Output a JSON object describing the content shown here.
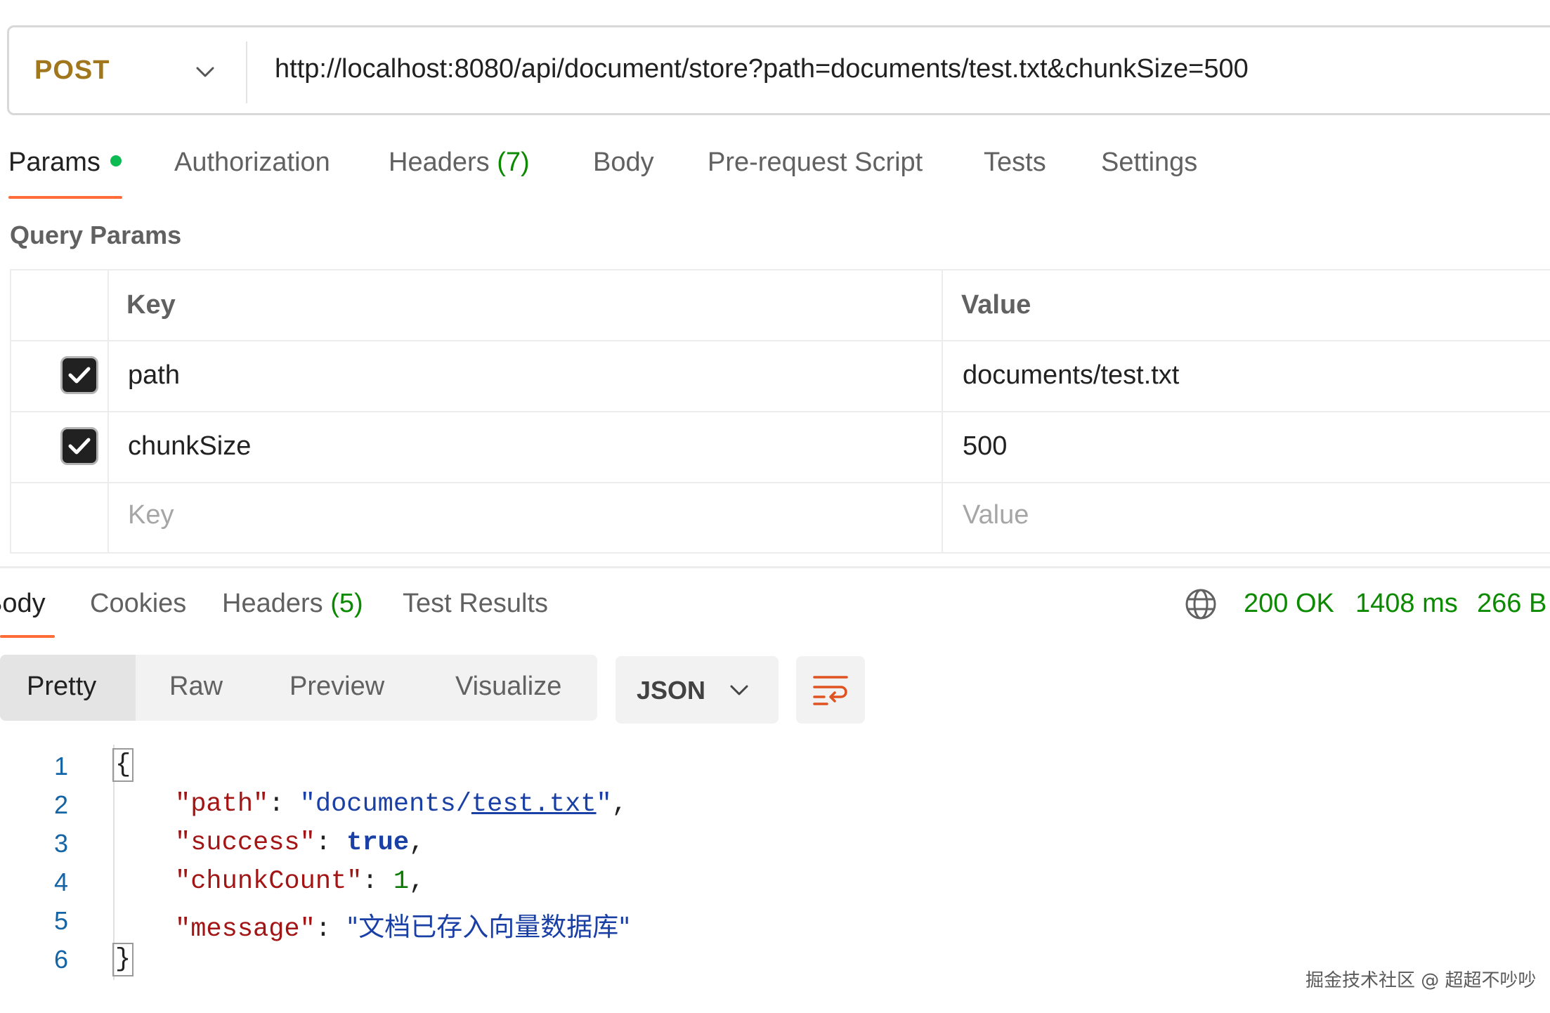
{
  "request": {
    "method": "POST",
    "url": "http://localhost:8080/api/document/store?path=documents/test.txt&chunkSize=500"
  },
  "request_tabs": [
    {
      "label": "Params",
      "active": true
    },
    {
      "label": "Authorization"
    },
    {
      "label": "Headers",
      "count": "(7)"
    },
    {
      "label": "Body"
    },
    {
      "label": "Pre-request Script"
    },
    {
      "label": "Tests"
    },
    {
      "label": "Settings"
    }
  ],
  "query_params": {
    "title": "Query Params",
    "columns": [
      "Key",
      "Value"
    ],
    "rows": [
      {
        "checked": true,
        "key": "path",
        "value": "documents/test.txt"
      },
      {
        "checked": true,
        "key": "chunkSize",
        "value": "500"
      }
    ],
    "placeholder": {
      "key": "Key",
      "value": "Value"
    }
  },
  "response_tabs": [
    {
      "label": "Body",
      "active": true
    },
    {
      "label": "Cookies"
    },
    {
      "label": "Headers",
      "count": "(5)"
    },
    {
      "label": "Test Results"
    }
  ],
  "response_meta": {
    "status": "200 OK",
    "time": "1408 ms",
    "size": "266 B"
  },
  "format_tabs": [
    "Pretty",
    "Raw",
    "Preview",
    "Visualize"
  ],
  "language": "JSON",
  "code": {
    "line_numbers": [
      "1",
      "2",
      "3",
      "4",
      "5",
      "6"
    ],
    "open_brace": "{",
    "close_brace": "}",
    "path_key": "\"path\"",
    "path_value_prefix": "\"documents/",
    "path_value_link": "test.txt",
    "path_value_suffix": "\"",
    "success_key": "\"success\"",
    "success_value": "true",
    "chunkcount_key": "\"chunkCount\"",
    "chunkcount_value": "1",
    "message_key": "\"message\"",
    "message_value": "\"文档已存入向量数据库\""
  },
  "watermark": "掘金技术社区 @ 超超不吵吵",
  "colors": {
    "accent_orange": "#ff6c37",
    "status_green": "#0b8a00",
    "method_post": "#a0771c"
  }
}
